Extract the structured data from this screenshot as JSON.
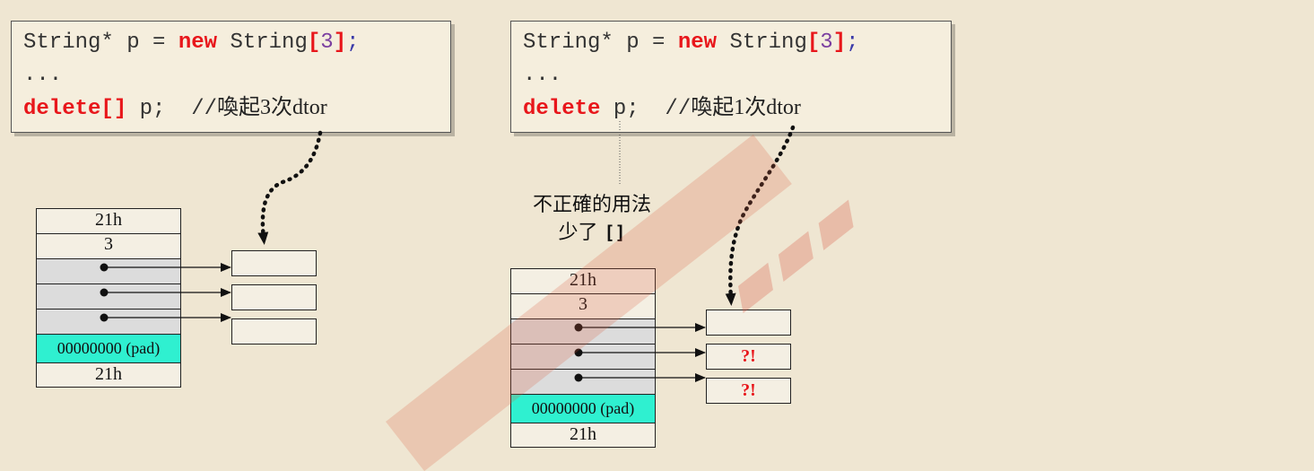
{
  "left": {
    "code": {
      "line1": {
        "prefix": "String* p = ",
        "kw": "new",
        "mid": " String",
        "ob": "[",
        "num": "3",
        "cb": "]",
        "semi": ";"
      },
      "line2": "...",
      "line3": {
        "kw": "delete[]",
        "mid": " p;  //",
        "comment": "喚起3次dtor"
      }
    },
    "cells": [
      "21h",
      "3",
      "",
      "",
      "",
      "00000000 (pad)",
      "21h"
    ]
  },
  "right": {
    "code": {
      "line1": {
        "prefix": "String* p = ",
        "kw": "new",
        "mid": " String",
        "ob": "[",
        "num": "3",
        "cb": "]",
        "semi": ";"
      },
      "line2": "...",
      "line3": {
        "kw": "delete",
        "mid": " p;  //",
        "comment": "喚起1次dtor"
      }
    },
    "caption_line1": "不正確的用法",
    "caption_line2_text": "少了",
    "caption_line2_code": "[]",
    "cells": [
      "21h",
      "3",
      "",
      "",
      "",
      "00000000 (pad)",
      "21h"
    ],
    "targets": [
      "",
      "?!",
      "?!"
    ]
  },
  "colors": {
    "background": "#efe6d2",
    "keyword": "#e8161b",
    "pad": "#2ff0d0",
    "grey_cell": "#dcdcdc"
  }
}
